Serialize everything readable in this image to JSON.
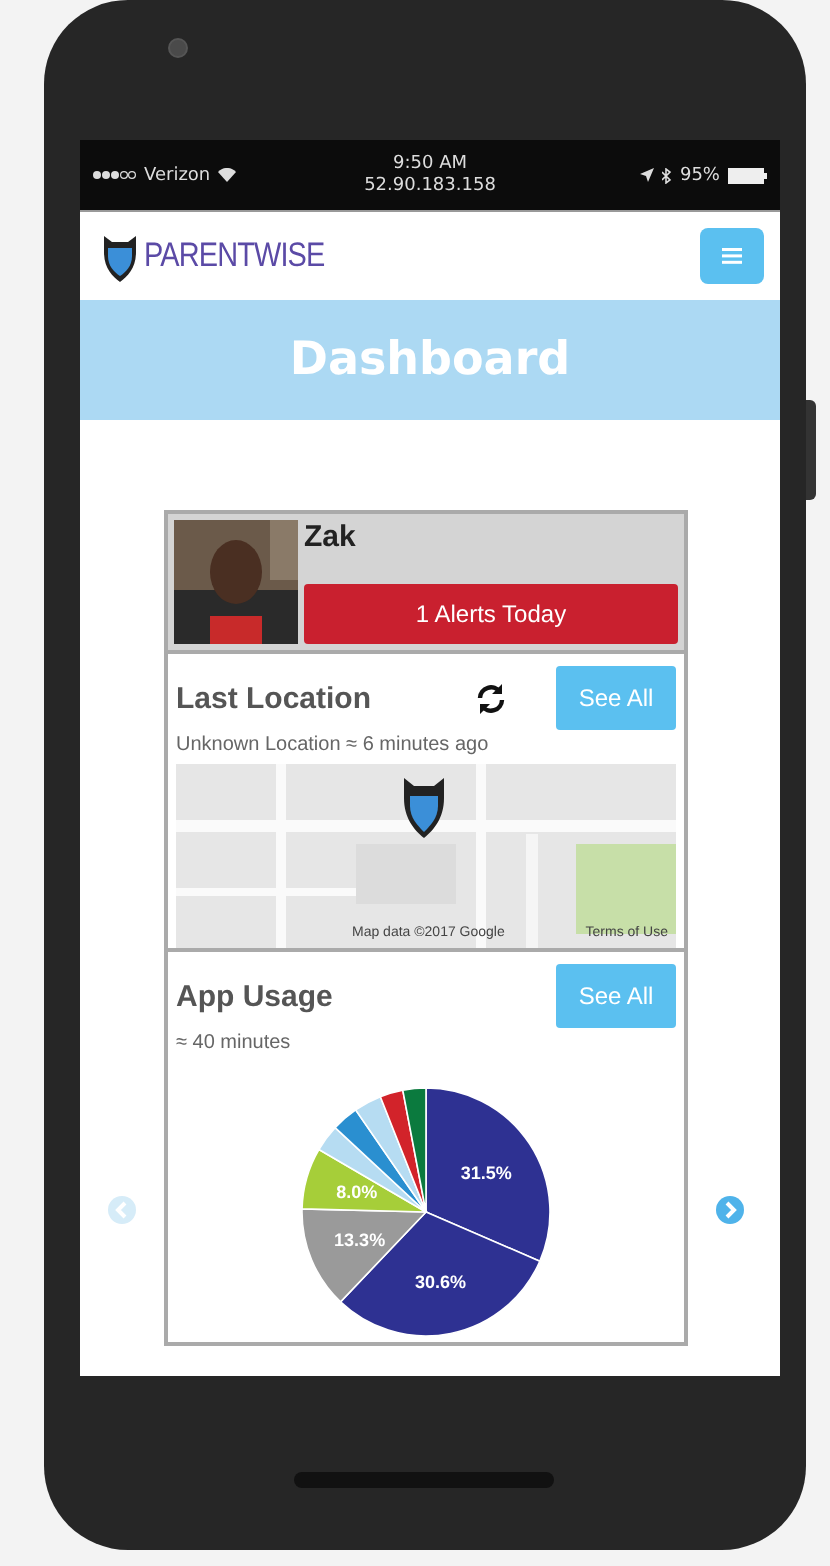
{
  "status_bar": {
    "carrier": "Verizon",
    "time": "9:50 AM",
    "ip": "52.90.183.158",
    "battery": "95%"
  },
  "nav": {
    "brand": "PARENTWISE"
  },
  "banner": {
    "title": "Dashboard"
  },
  "carousel": {
    "prev": {
      "disabled": true
    },
    "next": {
      "disabled": false
    }
  },
  "card": {
    "child": {
      "name": "Zak",
      "alerts": "1 Alerts Today"
    },
    "location": {
      "title": "Last Location",
      "button": "See All",
      "subtitle": "Unknown Location ≈ 6 minutes ago",
      "map": {
        "kind": "picture",
        "attribution": "Map data ©2017 Google",
        "terms": "Terms of Use"
      }
    },
    "usage": {
      "title": "App Usage",
      "button": "See All",
      "subtitle": "≈ 40 minutes",
      "chart_data": {
        "type": "pie",
        "values": [
          31.5,
          30.6,
          13.3,
          8.0,
          3.5,
          3.5,
          3.6,
          3.0,
          3.0
        ],
        "colors": [
          "#2e3192",
          "#2e3192",
          "#9a9a9a",
          "#a6ce39",
          "#b6dcf2",
          "#2a8fd0",
          "#b6dcf2",
          "#d2232a",
          "#0b7a3e"
        ],
        "value_labels": [
          "31.5%",
          "30.6%",
          "13.3%",
          "8.0%",
          null,
          null,
          null,
          null,
          null
        ]
      }
    }
  }
}
